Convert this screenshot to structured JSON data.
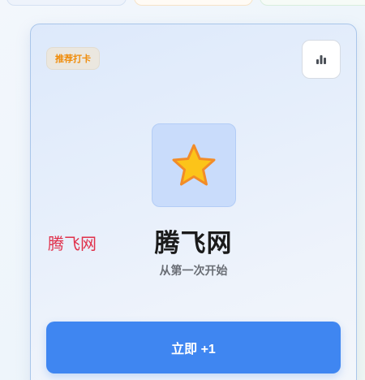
{
  "card": {
    "badge_label": "推荐打卡",
    "stats_icon": "bar-chart-icon",
    "main_icon": "star-icon",
    "title": "腾飞网",
    "subtitle": "从第一次开始",
    "action_label": "立即 +1",
    "accent_color": "#3f86f1",
    "badge_color": "#f08c0a"
  },
  "watermark": {
    "text": "腾飞网",
    "color": "#e0304a"
  }
}
